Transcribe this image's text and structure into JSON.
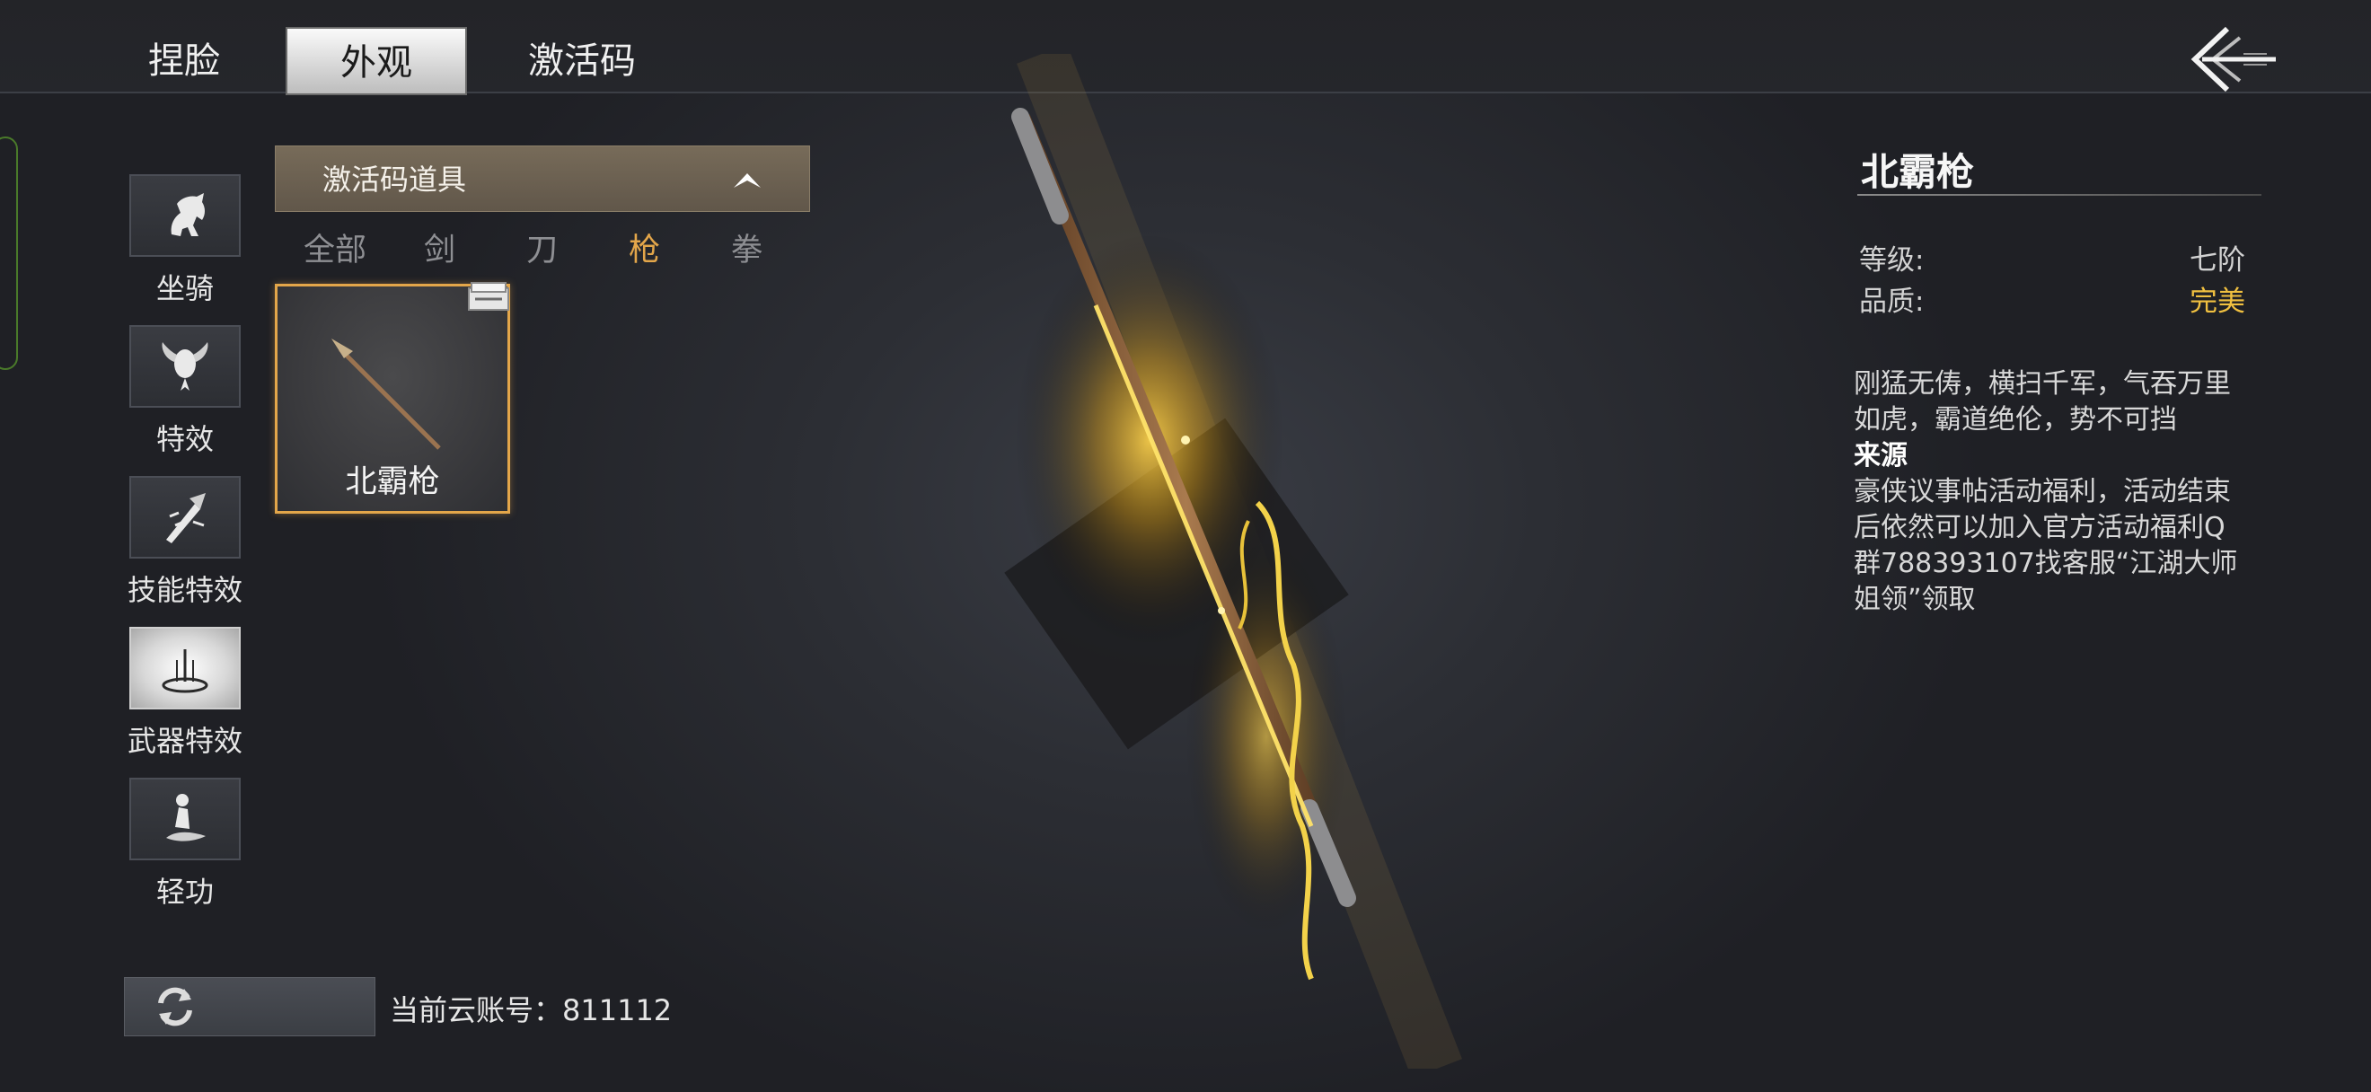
{
  "top_tabs": [
    {
      "label": "捏脸",
      "active": false
    },
    {
      "label": "外观",
      "active": true
    },
    {
      "label": "激活码",
      "active": false
    }
  ],
  "categories": [
    {
      "label": "坐骑",
      "icon": "horse-icon",
      "active": false
    },
    {
      "label": "特效",
      "icon": "wing-effect-icon",
      "active": false
    },
    {
      "label": "技能特效",
      "icon": "skill-effect-icon",
      "active": false
    },
    {
      "label": "武器特效",
      "icon": "weapon-effect-icon",
      "active": true
    },
    {
      "label": "轻功",
      "icon": "qinggong-icon",
      "active": false
    }
  ],
  "dropdown": {
    "label": "激活码道具",
    "expanded": true
  },
  "filters": [
    {
      "label": "全部",
      "active": false
    },
    {
      "label": "剑",
      "active": false
    },
    {
      "label": "刀",
      "active": false
    },
    {
      "label": "枪",
      "active": true
    },
    {
      "label": "拳",
      "active": false
    }
  ],
  "items": [
    {
      "name": "北霸枪",
      "selected": true
    }
  ],
  "account": {
    "text": "当前云账号：811112"
  },
  "detail": {
    "title": "北霸枪",
    "level_label": "等级:",
    "level_value": "七阶",
    "quality_label": "品质:",
    "quality_value": "完美",
    "quality_color": "#f0c040",
    "flavor": "刚猛无俦，横扫千军，气吞万里如虎，霸道绝伦，势不可挡",
    "source_heading": "来源",
    "source_text": "豪侠议事帖活动福利，活动结束后依然可以加入官方活动福利Q群788393107找客服“江湖大师姐领”领取"
  },
  "accent_color": "#e3a64a"
}
